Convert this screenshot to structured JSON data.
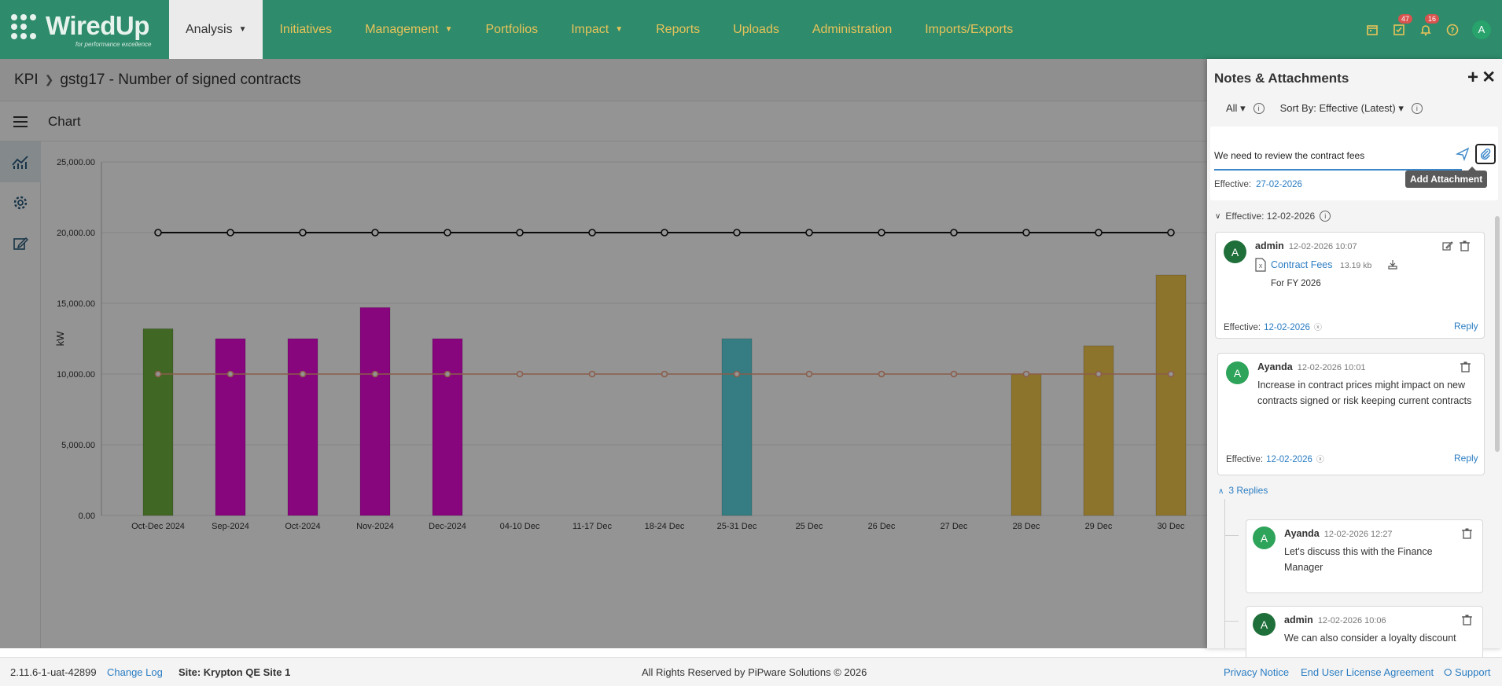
{
  "brand": {
    "name": "WiredUp",
    "tagline": "for performance excellence"
  },
  "nav": {
    "items": [
      {
        "label": "Analysis",
        "caret": true,
        "active": true
      },
      {
        "label": "Initiatives",
        "caret": false
      },
      {
        "label": "Management",
        "caret": true
      },
      {
        "label": "Portfolios",
        "caret": false
      },
      {
        "label": "Impact",
        "caret": true
      },
      {
        "label": "Reports",
        "caret": false
      },
      {
        "label": "Uploads",
        "caret": false
      },
      {
        "label": "Administration",
        "caret": false
      },
      {
        "label": "Imports/Exports",
        "caret": false
      }
    ],
    "badges": {
      "tasks": "47",
      "notifications": "16"
    },
    "avatar": "A"
  },
  "breadcrumb": {
    "root": "KPI",
    "current": "gstg17 - Number of signed contracts"
  },
  "toolbar": {
    "title": "Chart"
  },
  "chart_data": {
    "type": "bar",
    "title": "",
    "ylabel": "kW",
    "ylim": [
      0,
      25000
    ],
    "yticks": [
      "25,000.00",
      "20,000.00",
      "15,000.00",
      "10,000.00",
      "5,000.00",
      "0.00"
    ],
    "categories": [
      "Oct-Dec 2024",
      "Sep-2024",
      "Oct-2024",
      "Nov-2024",
      "Dec-2024",
      "04-10 Dec",
      "11-17 Dec",
      "18-24 Dec",
      "25-31 Dec",
      "25 Dec",
      "26 Dec",
      "27 Dec",
      "28 Dec",
      "29 Dec",
      "30 Dec"
    ],
    "values": [
      13200,
      12500,
      12500,
      14700,
      12500,
      null,
      null,
      null,
      12500,
      null,
      null,
      null,
      10000,
      12000,
      17000
    ],
    "bar_colors": [
      "#6fb23e",
      "#e80ad8",
      "#e80ad8",
      "#e80ad8",
      "#e80ad8",
      null,
      null,
      null,
      "#5cd8e0",
      null,
      null,
      null,
      "#f2c84f",
      "#f2c84f",
      "#f2c84f"
    ],
    "series": [
      {
        "values": [
          20000,
          20000,
          20000,
          20000,
          20000,
          20000,
          20000,
          20000,
          20000,
          20000,
          20000,
          20000,
          20000,
          20000,
          20000
        ],
        "color": "#111111"
      },
      {
        "values": [
          10000,
          10000,
          10000,
          10000,
          10000,
          10000,
          10000,
          10000,
          10000,
          10000,
          10000,
          10000,
          10000,
          10000,
          10000
        ],
        "color": "#f0a080"
      }
    ],
    "grid": true
  },
  "notes": {
    "title": "Notes & Attachments",
    "filter": "All",
    "sort": "Sort By: Effective (Latest)",
    "compose": {
      "text": "We need to review the contract fees",
      "effective_label": "Effective:",
      "effective_date": "27-02-2026",
      "tooltip": "Add Attachment"
    },
    "group": "Effective: 12-02-2026",
    "items": [
      {
        "author": "admin",
        "stamp": "12-02-2026 10:07",
        "file": "Contract Fees",
        "size": "13.19 kb",
        "desc": "For FY 2026",
        "effective_label": "Effective:",
        "effective": "12-02-2026",
        "reply": "Reply"
      },
      {
        "author": "Ayanda",
        "stamp": "12-02-2026 10:01",
        "body": "Increase in contract prices might impact on new contracts signed or risk keeping current contracts",
        "effective_label": "Effective:",
        "effective": "12-02-2026",
        "reply": "Reply"
      }
    ],
    "replies_label": "3 Replies",
    "replies": [
      {
        "author": "Ayanda",
        "stamp": "12-02-2026 12:27",
        "body": "Let's discuss this with the Finance Manager"
      },
      {
        "author": "admin",
        "stamp": "12-02-2026 10:06",
        "body": "We can also consider a loyalty discount"
      }
    ]
  },
  "footer": {
    "version": "2.11.6-1-uat-42899",
    "changelog": "Change Log",
    "site": "Site: Krypton QE Site 1",
    "rights": "All Rights Reserved by PiPware Solutions © 2026",
    "privacy": "Privacy Notice",
    "eula": "End User License Agreement",
    "support": "Support"
  }
}
